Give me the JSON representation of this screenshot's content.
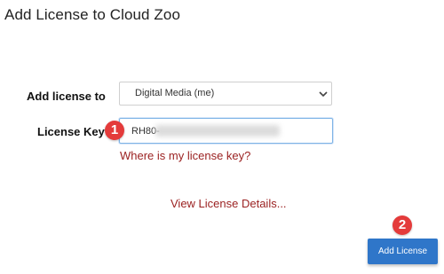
{
  "header": {
    "title": "Add License to Cloud Zoo"
  },
  "form": {
    "add_license_to_label": "Add license to",
    "add_license_to_value": "Digital Media (me)",
    "license_key_label": "License Key",
    "license_key_prefix": "RH80-",
    "where_link": "Where is my license key?",
    "view_details_link": "View License Details..."
  },
  "callouts": {
    "step1": "1",
    "step2": "2"
  },
  "actions": {
    "add_license_label": "Add License"
  },
  "colors": {
    "accent": "#2f76c9",
    "link": "#9a1f1f",
    "badge": "#e43b3b"
  },
  "icons": {
    "select_chevron": "chevron-down-icon"
  }
}
